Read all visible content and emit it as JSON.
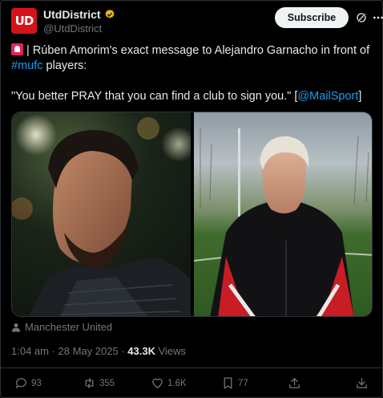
{
  "author": {
    "display_name": "UtdDistrict",
    "handle": "@UtdDistrict",
    "avatar_text": "UD"
  },
  "header": {
    "subscribe_label": "Subscribe",
    "icons": [
      "verified-badge-icon",
      "grok-icon",
      "more-icon"
    ]
  },
  "post": {
    "line1": "| Rúben Amorim's exact message to Alejandro Garnacho in front of",
    "hashtag": "#mufc",
    "line2_rest": " players:",
    "quote": "\"You better PRAY that you can find a club to sign you.\" [",
    "mention": "@MailSport",
    "quote_end": "]"
  },
  "media": {
    "images": [
      "amorim-photo",
      "garnacho-photo"
    ]
  },
  "location": {
    "label": "Manchester United"
  },
  "meta": {
    "time": "1:04 am",
    "separator": " · ",
    "date": "28 May 2025",
    "views_count": "43.3K",
    "views_label": " Views"
  },
  "actions": {
    "replies": "93",
    "reposts": "355",
    "likes": "1.6K",
    "bookmarks": "77"
  },
  "colors": {
    "background": "#000000",
    "text": "#e7e9ea",
    "muted": "#71767b",
    "link": "#1d9bf0",
    "brand": "#d4121a",
    "verified": "#e2b719"
  }
}
